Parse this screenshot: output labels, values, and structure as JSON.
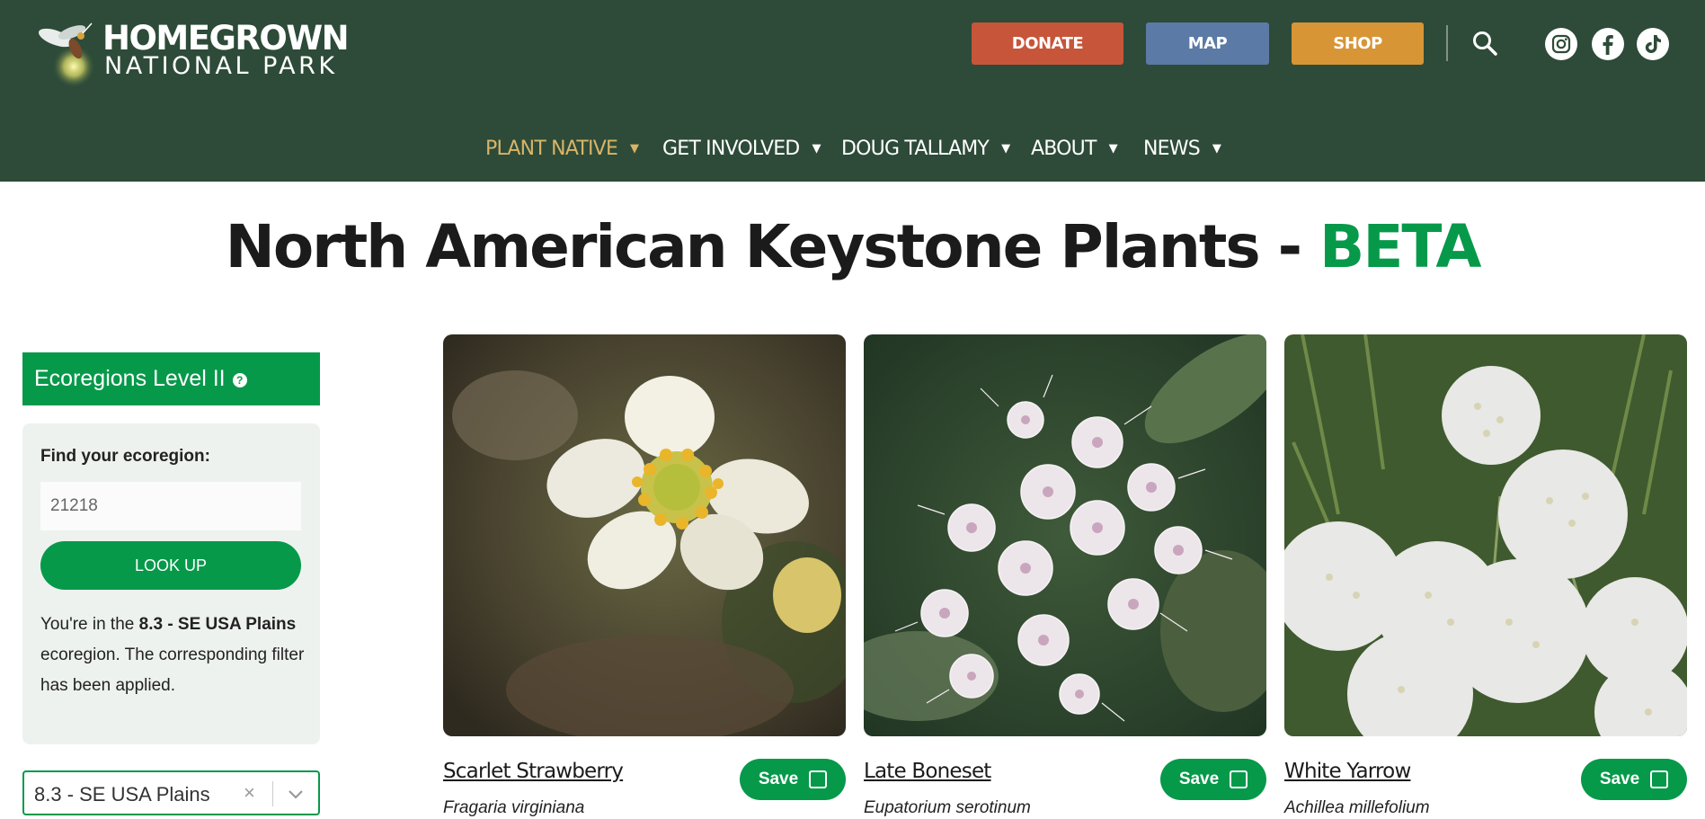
{
  "header": {
    "logo_line1": "HOMEGROWN",
    "logo_line2": "NATIONAL PARK",
    "buttons": {
      "donate": "DONATE",
      "map": "MAP",
      "shop": "SHOP"
    },
    "social_icons": [
      "instagram-icon",
      "facebook-icon",
      "tiktok-icon"
    ],
    "nav": [
      {
        "label": "PLANT NATIVE",
        "active": true
      },
      {
        "label": "GET INVOLVED"
      },
      {
        "label": "DOUG TALLAMY"
      },
      {
        "label": "ABOUT"
      },
      {
        "label": "NEWS"
      }
    ]
  },
  "page": {
    "title_main": "North American Keystone Plants - ",
    "title_accent": "BETA"
  },
  "sidebar": {
    "section_title": "Ecoregions Level II",
    "find_label": "Find your ecoregion:",
    "zip_value": "21218",
    "lookup_label": "LOOK UP",
    "msg_prefix": "You're in the ",
    "msg_region": "8.3 - SE USA Plains",
    "msg_suffix": " ecoregion. The corresponding filter has been applied.",
    "selected_ecoregion": "8.3 - SE USA Plains",
    "clear_symbol": "×"
  },
  "plants": [
    {
      "name": "Scarlet Strawberry",
      "scientific": "Fragaria virginiana",
      "save_label": "Save"
    },
    {
      "name": "Late Boneset",
      "scientific": "Eupatorium serotinum",
      "save_label": "Save"
    },
    {
      "name": "White Yarrow",
      "scientific": "Achillea millefolium",
      "save_label": "Save"
    }
  ],
  "colors": {
    "header_bg": "#2d4b38",
    "brand_green": "#06994a",
    "donate": "#c7553a",
    "map": "#5b7aa6",
    "shop": "#d79536",
    "nav_active": "#d9b468"
  }
}
